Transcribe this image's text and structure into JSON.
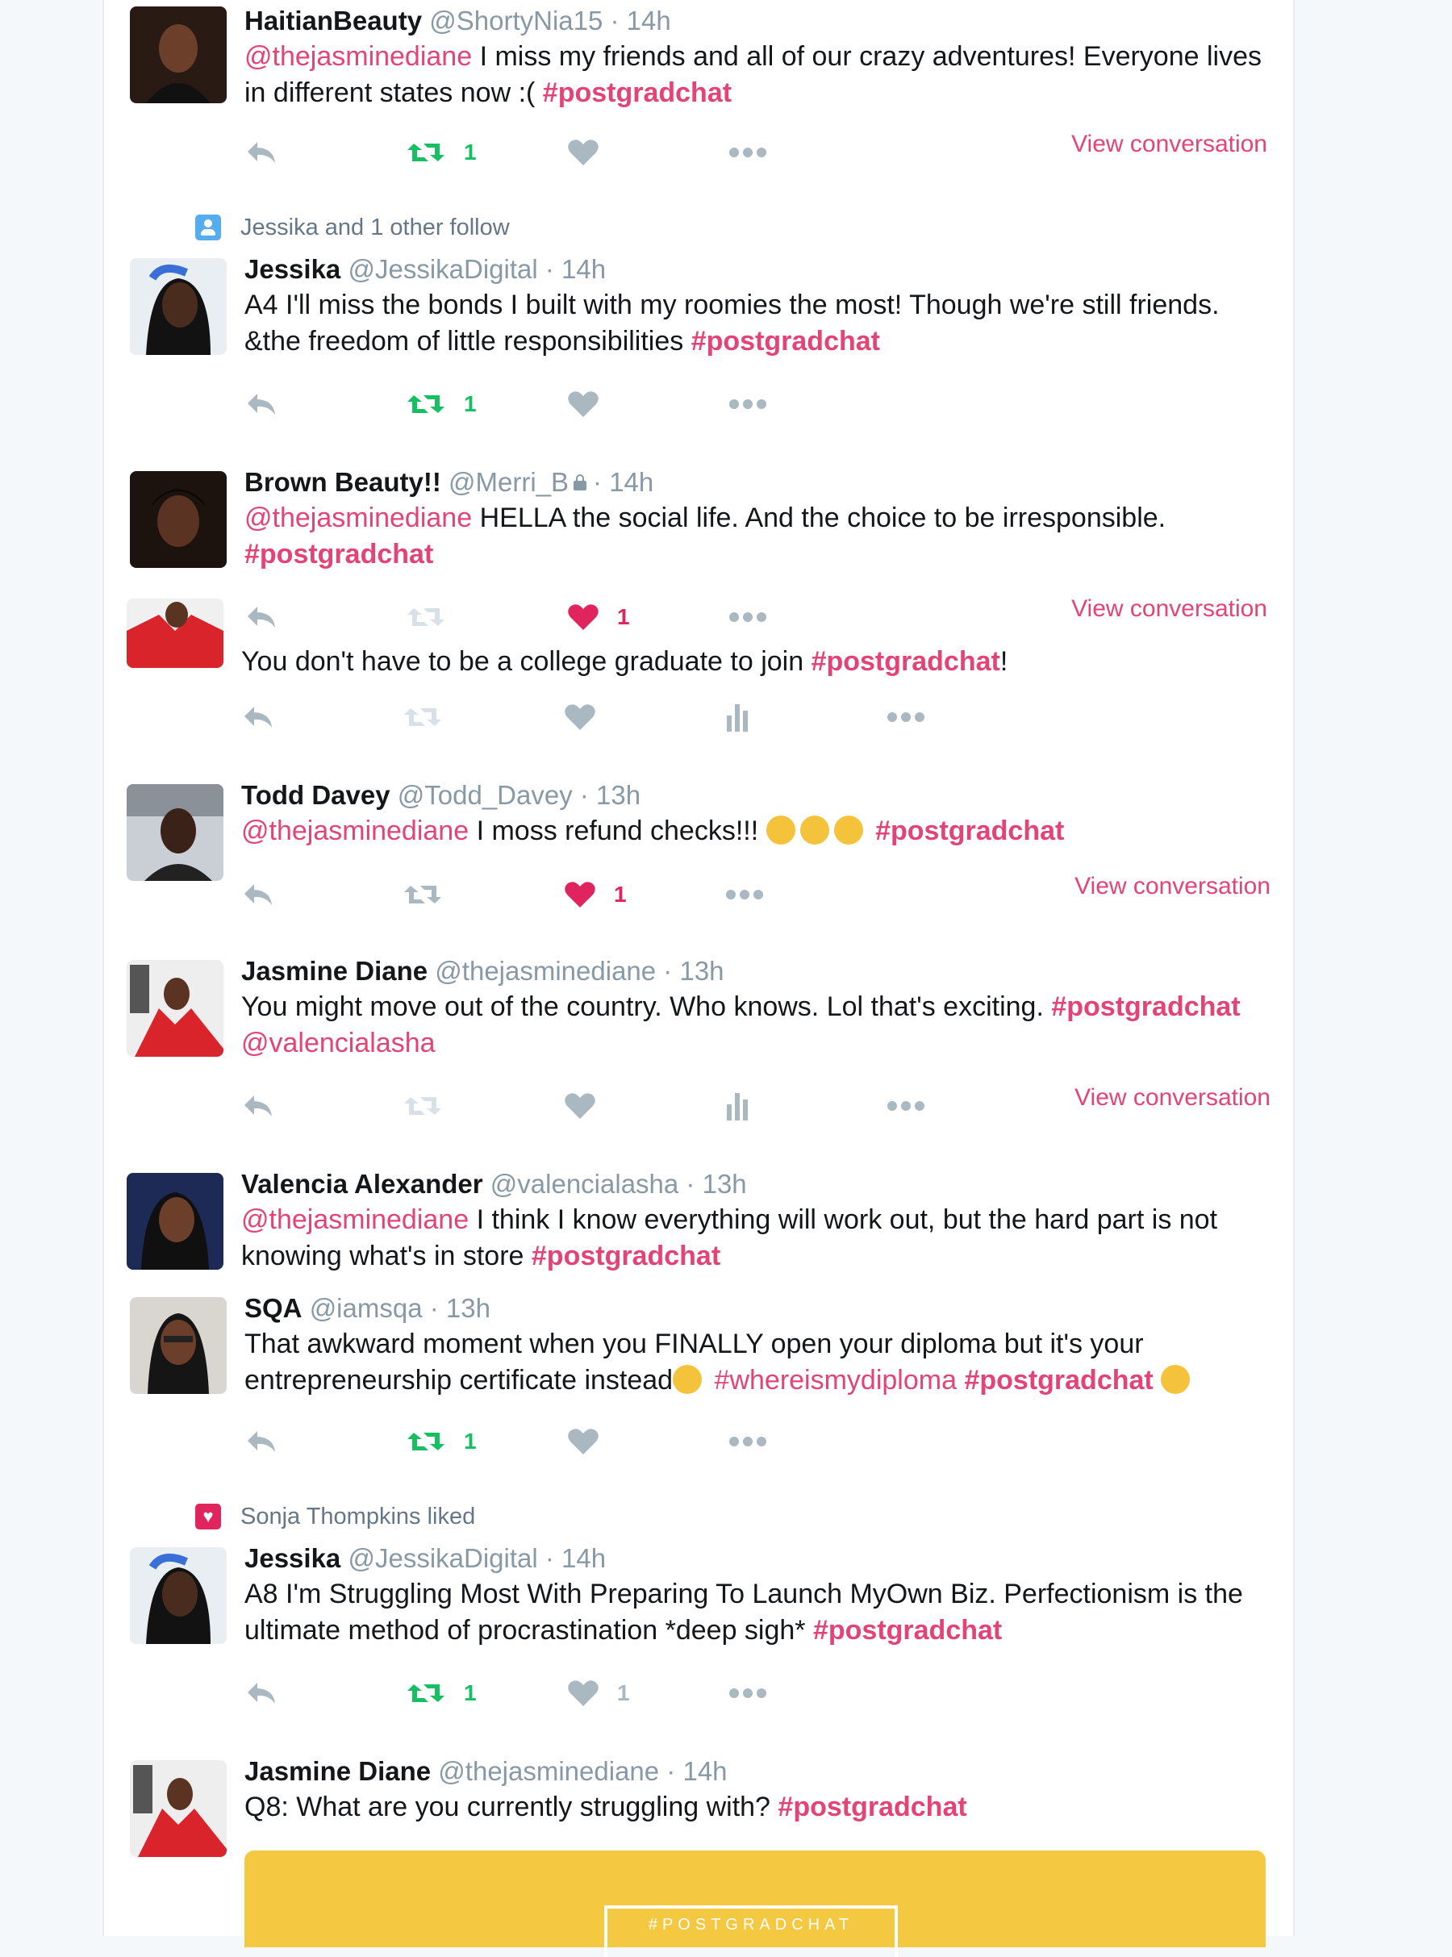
{
  "tweets": [
    {
      "name": "HaitianBeauty",
      "handle": "@ShortyNia15",
      "time": "14h",
      "text": [
        {
          "m": "@thejasminediane"
        },
        {
          "t": " I miss my friends and all of our crazy adventures! Everyone lives in different states now :( "
        },
        {
          "h": "#postgradchat"
        }
      ],
      "retweets": "1",
      "likes": "",
      "view_conversation": "View conversation"
    },
    {
      "social": "Jessika and 1 other follow",
      "name": "Jessika",
      "handle": "@JessikaDigital",
      "time": "14h",
      "text": [
        {
          "t": "A4 I'll miss the bonds I built with my roomies the most! Though we're still friends. &the freedom of little responsibilities "
        },
        {
          "h": "#postgradchat"
        }
      ],
      "retweets": "1",
      "likes": ""
    },
    {
      "name": "Brown Beauty!!",
      "handle": "@Merri_B",
      "time": "14h",
      "text": [
        {
          "m": "@thejasminediane"
        },
        {
          "t": " HELLA the social life. And the choice to be irresponsible. "
        },
        {
          "h": "#postgradchat"
        }
      ],
      "retweets": "",
      "likes": "1",
      "view_conversation": "View conversation"
    },
    {
      "text": [
        {
          "t": "You don't have to be a college graduate to join "
        },
        {
          "h": "#postgradchat"
        },
        {
          "t": "!"
        }
      ],
      "retweets": "",
      "likes": ""
    },
    {
      "name": "Todd Davey",
      "handle": "@Todd_Davey",
      "time": "13h",
      "text": [
        {
          "m": "@thejasminediane"
        },
        {
          "t": " I moss refund checks!!! "
        },
        {
          "e": "face-with-tears-of-joy"
        },
        {
          "e": "face-with-tears-of-joy"
        },
        {
          "e": "face-with-tears-of-joy"
        },
        {
          "t": " "
        },
        {
          "h": "#postgradchat"
        }
      ],
      "retweets": "",
      "likes": "1",
      "view_conversation": "View conversation"
    },
    {
      "name": "Jasmine Diane",
      "handle": "@thejasminediane",
      "time": "13h",
      "text": [
        {
          "t": "You might move out of the country. Who knows. Lol that's exciting. "
        },
        {
          "h": "#postgradchat"
        },
        {
          "t": " "
        },
        {
          "m": "@valencialasha"
        }
      ],
      "retweets": "",
      "likes": "",
      "view_conversation": "View conversation"
    },
    {
      "name": "Valencia Alexander",
      "handle": "@valencialasha",
      "time": "13h",
      "text": [
        {
          "m": "@thejasminediane"
        },
        {
          "t": " I think I know everything will work out, but the hard part is not knowing what's in store "
        },
        {
          "h": "#postgradchat"
        }
      ]
    },
    {
      "name": "SQA",
      "handle": "@iamsqa",
      "time": "13h",
      "text": [
        {
          "t": "That awkward moment when you FINALLY open your diploma but it's your entrepreneurship certificate instead"
        },
        {
          "e": "flushed-face"
        },
        {
          "t": " "
        },
        {
          "m": "#whereismydiploma"
        },
        {
          "t": " "
        },
        {
          "h": "#postgradchat"
        },
        {
          "t": " "
        },
        {
          "e": "weary-face"
        }
      ],
      "retweets": "1",
      "likes": ""
    },
    {
      "social": "Sonja Thompkins liked",
      "name": "Jessika",
      "handle": "@JessikaDigital",
      "time": "14h",
      "text": [
        {
          "t": "A8 I'm Struggling Most With Preparing To Launch MyOwn Biz. Perfectionism is the ultimate method of procrastination *deep sigh* "
        },
        {
          "h": "#postgradchat"
        }
      ],
      "retweets": "1",
      "likes": "1"
    },
    {
      "name": "Jasmine Diane",
      "handle": "@thejasminediane",
      "time": "14h",
      "text": [
        {
          "t": "Q8: What are you currently struggling with? "
        },
        {
          "h": "#postgradchat"
        }
      ],
      "card_text": "#POSTGRADCHAT"
    }
  ],
  "icons": [
    "reply-icon",
    "retweet-icon",
    "like-icon",
    "analytics-icon",
    "more-icon",
    "follow-icon",
    "liked-icon",
    "lock-icon"
  ],
  "colors": {
    "accent": "#e0245e",
    "retweet": "#17bf63",
    "icon": "#aab8c2",
    "card": "#f5c842"
  }
}
